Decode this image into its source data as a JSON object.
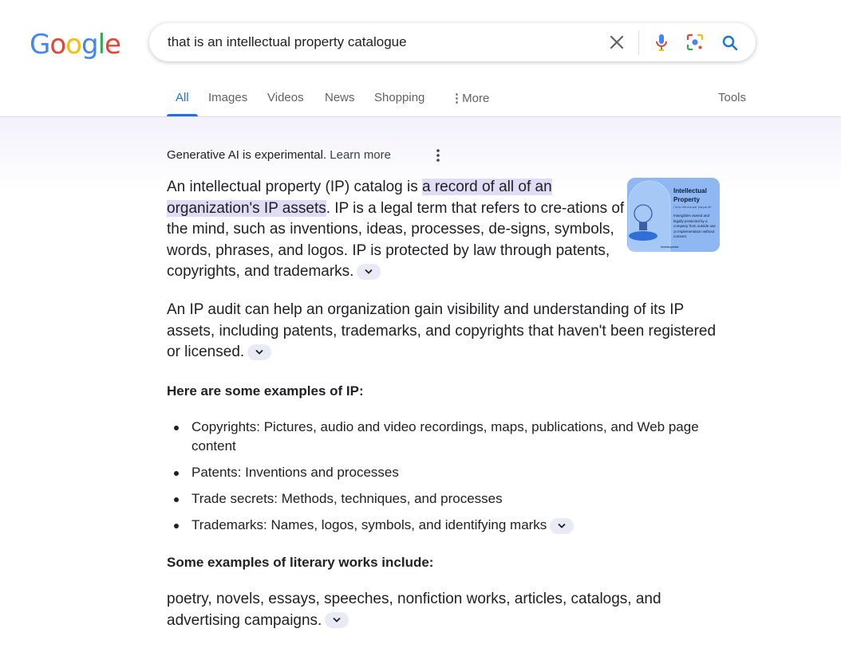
{
  "logo": {
    "letters": [
      "G",
      "o",
      "o",
      "g",
      "l",
      "e"
    ],
    "colors": [
      "#4285F4",
      "#EA4335",
      "#FBBC05",
      "#4285F4",
      "#34A853",
      "#EA4335"
    ]
  },
  "search": {
    "query": "that is an intellectual property catalogue"
  },
  "tabs": [
    {
      "label": "All",
      "active": true
    },
    {
      "label": "Images"
    },
    {
      "label": "Videos"
    },
    {
      "label": "News"
    },
    {
      "label": "Shopping"
    },
    {
      "label": "More"
    }
  ],
  "tools_label": "Tools",
  "ai": {
    "experimental_text": "Generative AI is experimental.",
    "learn_more": "Learn more",
    "p1_before": "An intellectual property (IP) catalog is ",
    "p1_highlight": "a record of all of an organization's IP assets",
    "p1_after": ". IP is a legal term that refers to cre-ations of the mind, such as inventions, ideas, processes, de-signs, symbols, words, phrases, and logos. IP is protected by law through patents, copyrights, and trademarks.",
    "p2": "An IP audit can help an organization gain visibility and understanding of its IP assets, including patents, trademarks, and copyrights that haven't been registered or licensed.",
    "heading1": "Here are some examples of IP:",
    "examples": [
      "Copyrights: Pictures, audio and video recordings, maps, publications, and Web page content",
      "Patents: Inventions and processes",
      "Trade secrets: Methods, techniques, and processes",
      "Trademarks: Names, logos, symbols, and identifying marks"
    ],
    "heading2": "Some examples of literary works include:",
    "p3": "poetry, novels, essays, speeches, nonfiction works, articles, catalogs, and advertising campaigns."
  },
  "thumbnail": {
    "title": "Intellectual Property",
    "subtitle": "/ˌin-tə-ˈlek-chə-wəl ˈprä-pər-tē/",
    "desc": "Intangibles owned and legally protected by a company from outside use or implementation without consent.",
    "credit": "investopedia",
    "bg_color": "#8fb8f2"
  },
  "colors": {
    "accent": "#1a73e8",
    "highlight": "#e1dcf6"
  }
}
